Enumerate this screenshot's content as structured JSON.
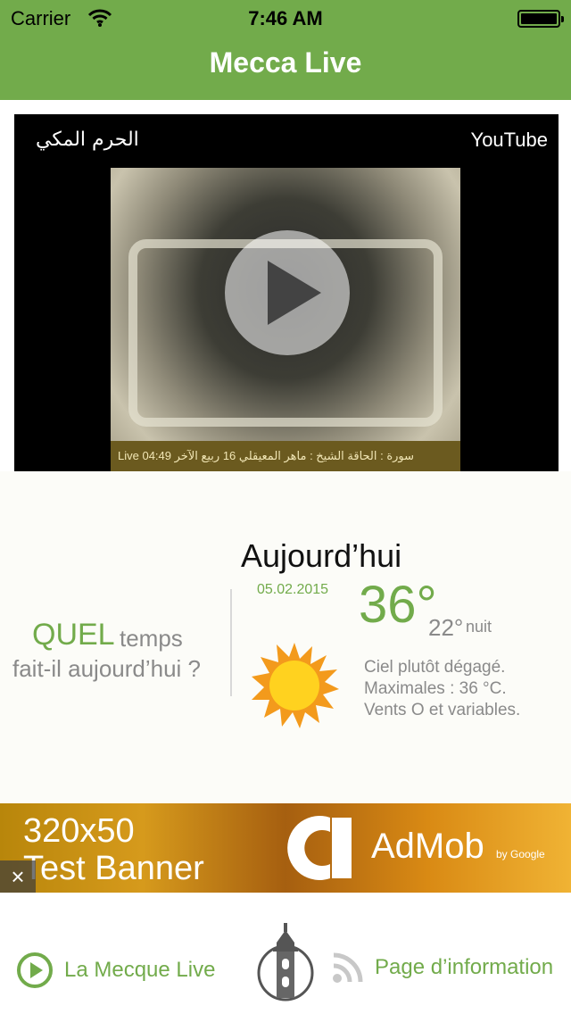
{
  "status_bar": {
    "carrier": "Carrier",
    "time": "7:46 AM"
  },
  "header": {
    "title": "Mecca Live",
    "background_color": "#72ab4b"
  },
  "video": {
    "title": "الحرم المكي",
    "source": "YouTube",
    "ticker": "Live 04:49   سورة : الحاقة   الشيخ : ماهر المعيقلي   16 ربيع الآخر",
    "play_icon": "play-icon"
  },
  "weather": {
    "headline_accent": "QUEL",
    "headline_rest": "temps",
    "headline_line2": "fait-il aujourd’hui ?",
    "day_label": "Aujourd’hui",
    "date": "05.02.2015",
    "temperature": "36°",
    "night_temperature": "22°",
    "night_label": "nuit",
    "condition_icon": "sun-icon",
    "description_lines": [
      "Ciel plutôt dégagé.",
      "Maximales : 36 °C.",
      "Vents O et variables."
    ]
  },
  "ad": {
    "size_text_line1": "320x50",
    "size_text_line2": "Test Banner",
    "brand": "AdMob",
    "brand_sub": "by Google",
    "close": "×"
  },
  "tabbar": {
    "left_label": "La Mecque Live",
    "right_label": "Page d’information",
    "accent_color": "#72ab4b"
  }
}
